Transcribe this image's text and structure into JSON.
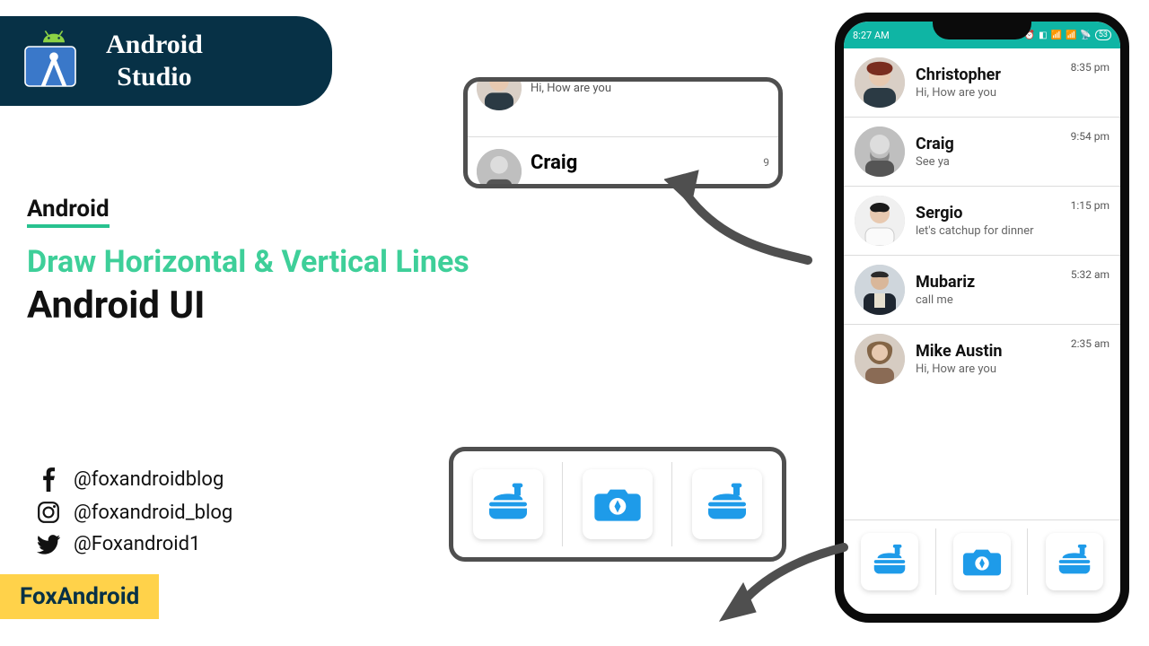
{
  "badge": {
    "line1": "Android",
    "line2": "Studio"
  },
  "left": {
    "tag": "Android",
    "headline1": "Draw Horizontal & Vertical Lines",
    "headline2": "Android UI"
  },
  "socials": {
    "facebook": "@foxandroidblog",
    "instagram": "@foxandroid_blog",
    "twitter": "@Foxandroid1"
  },
  "brand": "FoxAndroid",
  "phone": {
    "status": {
      "time": "8:27 AM",
      "battery": "53"
    },
    "chats": [
      {
        "name": "Christopher",
        "msg": "Hi, How are you",
        "time": "8:35 pm"
      },
      {
        "name": "Craig",
        "msg": "See ya",
        "time": "9:54 pm"
      },
      {
        "name": "Sergio",
        "msg": "let's catchup for dinner",
        "time": "1:15 pm"
      },
      {
        "name": "Mubariz",
        "msg": "call me",
        "time": "5:32 am"
      },
      {
        "name": "Mike Austin",
        "msg": "Hi, How are you",
        "time": "2:35 am"
      }
    ],
    "bottom_icons": [
      "food-icon",
      "camera-icon",
      "food-icon"
    ]
  },
  "callout_top": {
    "rows": [
      {
        "name": "",
        "msg": "Hi, How are you",
        "time": ""
      },
      {
        "name": "Craig",
        "msg": "",
        "time": "9"
      }
    ]
  },
  "callout_bottom": {
    "icons": [
      "food-icon",
      "camera-icon",
      "food-icon"
    ]
  }
}
